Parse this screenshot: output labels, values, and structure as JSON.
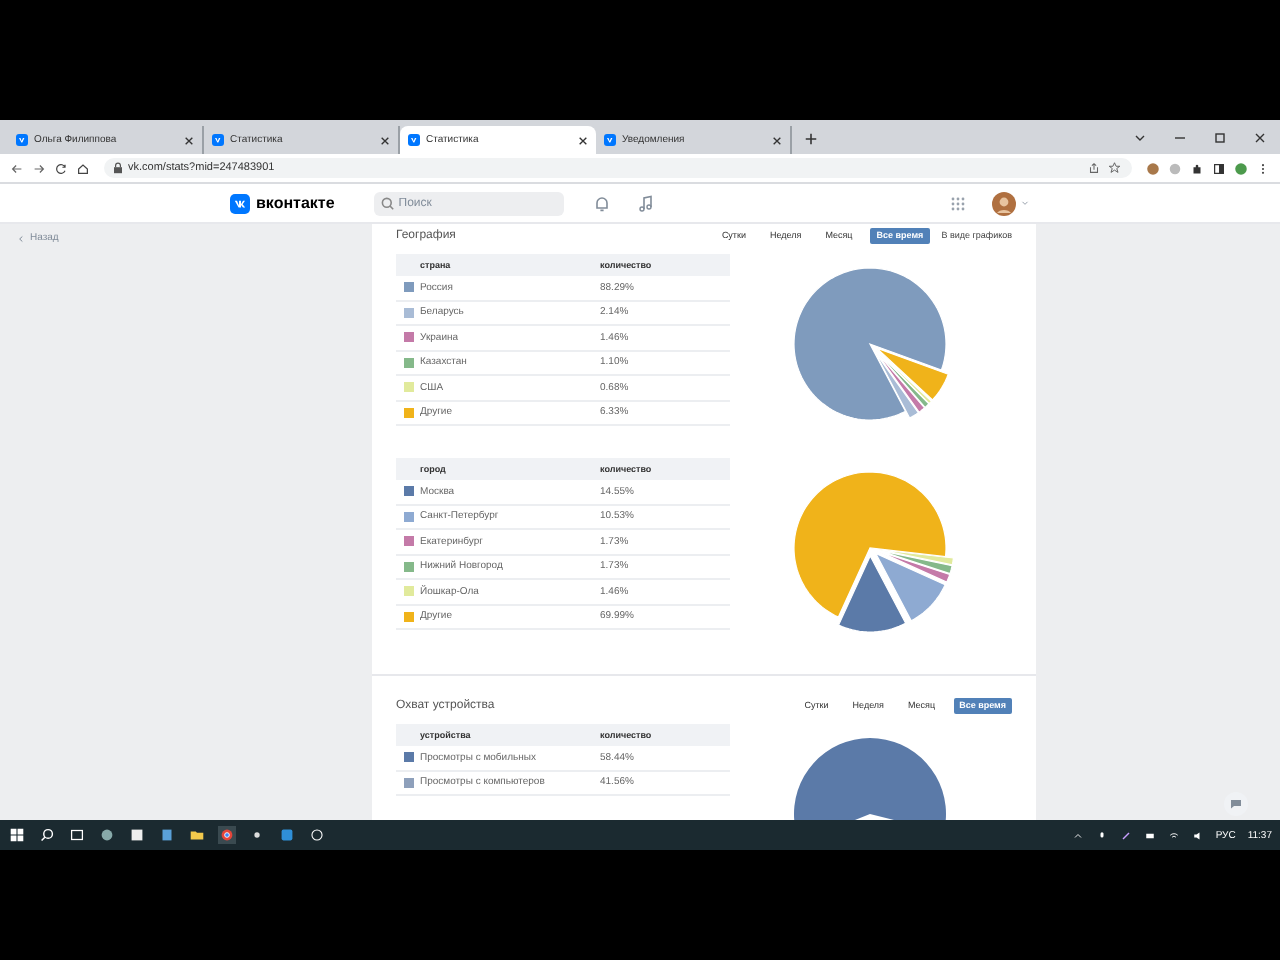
{
  "browser": {
    "tabs": [
      {
        "title": "Ольга Филиппова",
        "selected": false
      },
      {
        "title": "Статистика",
        "selected": false
      },
      {
        "title": "Статистика",
        "selected": true
      },
      {
        "title": "Уведомления",
        "selected": false
      }
    ],
    "address": "vk.com/stats?mid=247483901"
  },
  "header": {
    "logo": "вконтакте",
    "search": {
      "placeholder": "Поиск"
    }
  },
  "sidebar": {
    "back": "Назад"
  },
  "sections": [
    {
      "title": "География",
      "periods": [
        {
          "label": "Сутки",
          "selected": false
        },
        {
          "label": "Неделя",
          "selected": false
        },
        {
          "label": "Месяц",
          "selected": false
        },
        {
          "label": "Все время",
          "selected": true
        }
      ],
      "graph_link": "В виде графиков",
      "tables": [
        {
          "columns": [
            "страна",
            "количество"
          ],
          "rows": [
            {
              "name": "Россия",
              "value": "88.29%",
              "color": "#7f9bbd"
            },
            {
              "name": "Беларусь",
              "value": "2.14%",
              "color": "#a9bcd6"
            },
            {
              "name": "Украина",
              "value": "1.46%",
              "color": "#c47aa8"
            },
            {
              "name": "Казахстан",
              "value": "1.10%",
              "color": "#85b98a"
            },
            {
              "name": "США",
              "value": "0.68%",
              "color": "#e1ea9c"
            },
            {
              "name": "Другие",
              "value": "6.33%",
              "color": "#f0b31a"
            }
          ],
          "chart_data": {
            "type": "pie",
            "values": [
              88.29,
              2.14,
              1.46,
              1.1,
              0.68,
              6.33
            ]
          }
        },
        {
          "columns": [
            "город",
            "количество"
          ],
          "rows": [
            {
              "name": "Москва",
              "value": "14.55%",
              "color": "#5b7aa8"
            },
            {
              "name": "Санкт-Петербург",
              "value": "10.53%",
              "color": "#8eaad2"
            },
            {
              "name": "Екатеринбург",
              "value": "1.73%",
              "color": "#c47aa8"
            },
            {
              "name": "Нижний Новгород",
              "value": "1.73%",
              "color": "#85b98a"
            },
            {
              "name": "Йошкар-Ола",
              "value": "1.46%",
              "color": "#e1ea9c"
            },
            {
              "name": "Другие",
              "value": "69.99%",
              "color": "#f0b31a"
            }
          ],
          "chart_data": {
            "type": "pie",
            "values": [
              14.55,
              10.53,
              1.73,
              1.73,
              1.46,
              69.99
            ]
          }
        }
      ]
    },
    {
      "title": "Охват устройства",
      "periods": [
        {
          "label": "Сутки",
          "selected": false
        },
        {
          "label": "Неделя",
          "selected": false
        },
        {
          "label": "Месяц",
          "selected": false
        },
        {
          "label": "Все время",
          "selected": true
        }
      ],
      "tables": [
        {
          "columns": [
            "устройства",
            "количество"
          ],
          "rows": [
            {
              "name": "Просмотры с мобильных",
              "value": "58.44%",
              "color": "#5b7aa8"
            },
            {
              "name": "Просмотры с компьютеров",
              "value": "41.56%",
              "color": "#8ea0bb"
            }
          ]
        }
      ]
    }
  ],
  "taskbar": {
    "language": "РУС",
    "time": "11:37"
  }
}
